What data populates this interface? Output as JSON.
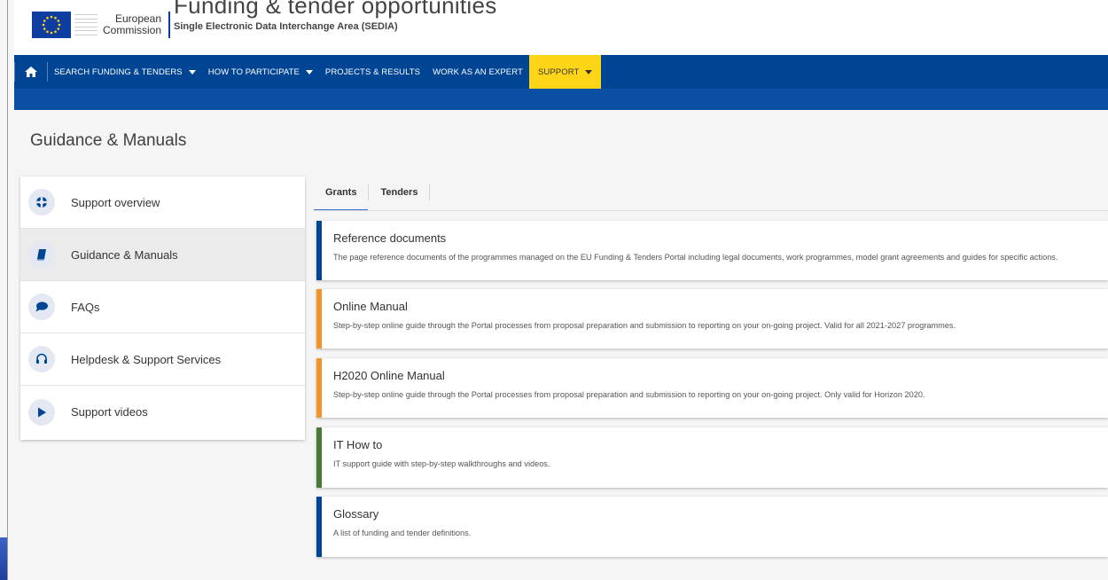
{
  "header": {
    "logo_line1": "European",
    "logo_line2": "Commission",
    "title": "Funding & tender opportunities",
    "subtitle": "Single Electronic Data Interchange Area (SEDIA)"
  },
  "nav": {
    "items": [
      {
        "label": "SEARCH FUNDING & TENDERS",
        "has_caret": true
      },
      {
        "label": "HOW TO PARTICIPATE",
        "has_caret": true
      },
      {
        "label": "PROJECTS & RESULTS",
        "has_caret": false
      },
      {
        "label": "WORK AS AN EXPERT",
        "has_caret": false
      },
      {
        "label": "SUPPORT",
        "has_caret": true,
        "active": true
      }
    ]
  },
  "page": {
    "title": "Guidance & Manuals"
  },
  "sidebar": {
    "items": [
      {
        "label": "Support overview",
        "icon": "lifebuoy-icon"
      },
      {
        "label": "Guidance & Manuals",
        "icon": "book-icon",
        "active": true
      },
      {
        "label": "FAQs",
        "icon": "speech-bubble-icon"
      },
      {
        "label": "Helpdesk & Support Services",
        "icon": "headset-icon"
      },
      {
        "label": "Support videos",
        "icon": "play-icon"
      }
    ]
  },
  "tabs": [
    {
      "label": "Grants",
      "active": true
    },
    {
      "label": "Tenders",
      "active": false
    }
  ],
  "cards": [
    {
      "title": "Reference documents",
      "desc": "The page reference documents of the programmes managed on the EU Funding & Tenders Portal including legal documents, work programmes, model grant agreements and guides for specific actions."
    },
    {
      "title": "Online Manual",
      "desc": "Step-by-step online guide through the Portal processes from proposal preparation and submission to reporting on your on-going project. Valid for all 2021-2027 programmes."
    },
    {
      "title": "H2020 Online Manual",
      "desc": "Step-by-step online guide through the Portal processes from proposal preparation and submission to reporting on your on-going project. Only valid for Horizon 2020."
    },
    {
      "title": "IT How to",
      "desc": "IT support guide with step-by-step walkthroughs and videos."
    },
    {
      "title": "Glossary",
      "desc": "A list of funding and tender definitions."
    }
  ],
  "colors": {
    "nav_blue": "#004494",
    "support_yellow": "#ffd617",
    "card_blue": "#004494",
    "card_orange": "#f29527",
    "card_green": "#467a39"
  }
}
